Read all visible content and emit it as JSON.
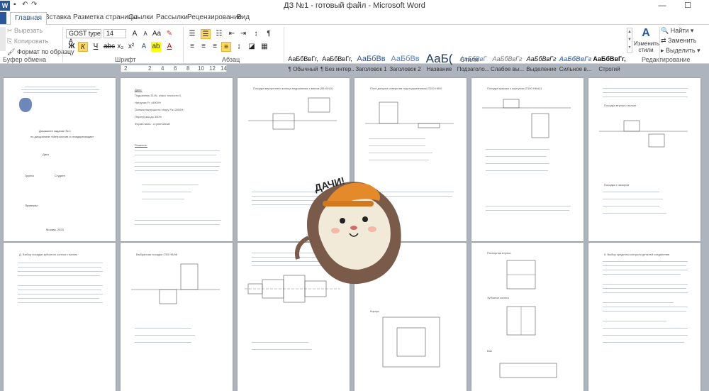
{
  "window": {
    "title": "ДЗ №1 - готовый файл - Microsoft Word",
    "app_icon_letter": "W",
    "minimize": "—",
    "maximize": "☐"
  },
  "tabs": [
    {
      "label": "Главная",
      "active": true
    },
    {
      "label": "Вставка"
    },
    {
      "label": "Разметка страницы"
    },
    {
      "label": "Ссылки"
    },
    {
      "label": "Рассылки"
    },
    {
      "label": "Рецензирование"
    },
    {
      "label": "Вид"
    }
  ],
  "clipboard": {
    "cut": "Вырезать",
    "copy": "Копировать",
    "format_painter": "Формат по образцу",
    "group": "Буфер обмена"
  },
  "font": {
    "name": "GOST type A",
    "size": "14",
    "group": "Шрифт",
    "bold": "Ж",
    "italic": "К",
    "underline": "Ч"
  },
  "paragraph": {
    "group": "Абзац",
    "pilcrow": "¶"
  },
  "styles": {
    "group": "Стили",
    "items": [
      {
        "preview": "АаБбВвГг,",
        "label": "¶ Обычный",
        "selected": false
      },
      {
        "preview": "АаБбВвГг,",
        "label": "¶ Без интер...",
        "selected": false
      },
      {
        "preview": "АаБбВв",
        "label": "Заголовок 1",
        "selected": false
      },
      {
        "preview": "АаБбВв",
        "label": "Заголовок 2",
        "selected": false
      },
      {
        "preview": "АаБ(",
        "label": "Название",
        "selected": false
      },
      {
        "preview": "АаБбВвГ",
        "label": "Подзаголо...",
        "selected": false
      },
      {
        "preview": "АаБбВвГг",
        "label": "Слабое вы...",
        "selected": false
      },
      {
        "preview": "АаБбВвГг",
        "label": "Выделение",
        "selected": false
      },
      {
        "preview": "АаБбВвГг",
        "label": "Сильное в...",
        "selected": false
      },
      {
        "preview": "АаБбВвГг,",
        "label": "Строгий",
        "selected": false
      }
    ],
    "change_styles": "Изменить стили"
  },
  "editing": {
    "group": "Редактирование",
    "find": "Найти",
    "replace": "Заменить",
    "select": "Выделить"
  },
  "ruler": {
    "marks": [
      "2",
      "2",
      "4",
      "6",
      "8",
      "10",
      "12",
      "14"
    ]
  },
  "pages": {
    "title_page": {
      "lines": [
        "Домашнее задание № 1",
        "по дисциплине «Метрология и стандартизация»",
        "Дата",
        "Группа",
        "Студент",
        "Проверил",
        "Москва, 2023"
      ]
    },
    "p2": {
      "heading": "Дано:",
      "lines": [
        "Подшипник 311N, класс точности 0,",
        "Нагрузка Fr =8000Н",
        "Осевая нагрузка на опору Fa=2600Н;",
        "Перегрузка до 300%",
        "Форма вала - ступенчатый",
        "Решение:"
      ]
    },
    "p3_title": "Посадка внутреннего кольца подшипника с валом (55 k5/L0)",
    "p4_title": "Поле допуска отверстия под подшипником ∅100 H6/l0",
    "p5_title": "Посадка крышки с корпусом ∅100 H6/d11",
    "p6_lines": [
      "Посадка с зазором",
      "Посадка втулки с валом"
    ],
    "p7_title": "Д. Выбор посадки зубчатого колеса с валом",
    "p8_title": "Выбранная посадка ∅53 H8/h8",
    "p10_labels": [
      "Распорная втулка",
      "Корпус"
    ],
    "p11_labels": [
      "Зубчатое колесо",
      "Вал"
    ],
    "p12_title": "6. Выбор средства контроля деталей соединения"
  },
  "sticker": {
    "speech": "ДАЧИ!"
  },
  "colors": {
    "accent": "#2b579a",
    "highlight": "#fbd867",
    "doc_bg": "#aeb4be"
  }
}
